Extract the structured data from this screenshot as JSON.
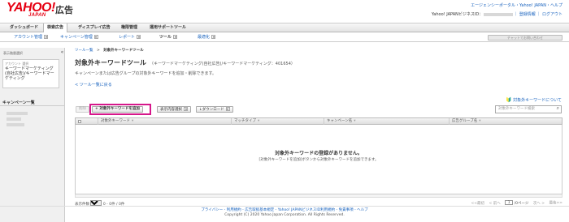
{
  "header": {
    "logo_main": "YAHOO!",
    "logo_sub": "JAPAN",
    "logo_product": "広告",
    "top_links": "エージェンシーポータル・Yahoo! JAPAN・ヘルプ",
    "user_prefix": "Yahoo! JAPANビジネスID：",
    "user_links": "｜ 登録情報 ｜ ログアウト"
  },
  "main_tabs": [
    {
      "label": "ダッシュボード"
    },
    {
      "label": "検索広告"
    },
    {
      "label": "ディスプレイ広告"
    },
    {
      "label": "権限管理"
    },
    {
      "label": "運用サポートツール"
    }
  ],
  "sub_nav": [
    {
      "label": "アカウント管理"
    },
    {
      "label": "キャンペーン管理"
    },
    {
      "label": "レポート"
    },
    {
      "label": "ツール"
    },
    {
      "label": "最適化"
    }
  ],
  "chat_button": "チャットでお問い合わせ",
  "sidebar": {
    "section_label": "表示階層選択",
    "account_type_label": "アカウント 選択",
    "account_name": "キーワードマーケティング(自社広告)/キーワードマーケティング",
    "collapse": "«",
    "campaign_header": "キャンペーン一覧"
  },
  "breadcrumb": {
    "parent": "ツール一覧",
    "separator": ">",
    "current": "対象外キーワードツール"
  },
  "page": {
    "title": "対象外キーワードツール",
    "account_info": "（キーワードマーケティング(自社広告)/キーワードマーケティング：401654）",
    "description": "キャンペーンまたは広告グループの対象外キーワードを追加・削除できます。",
    "back_link": "< ツール一覧に戻る",
    "about_link": "対象外キーワードについて"
  },
  "toolbar": {
    "delete": "削除",
    "add": "+ 対象外キーワードを追加",
    "view": "表示内容選択",
    "download": "↓ダウンロード",
    "search_placeholder": "対象外キーワード検索"
  },
  "table": {
    "columns": [
      {
        "label": "対象外キーワード"
      },
      {
        "label": "マッチタイプ"
      },
      {
        "label": "キャンペーン名"
      },
      {
        "label": "広告グループ名"
      }
    ],
    "empty_title": "対象外キーワードの登録がありません。",
    "empty_hint": "[対象外キーワードを追加]ボタンから対象外キーワードを追加できます。"
  },
  "pager": {
    "label": "表示件数",
    "per_page": "20件",
    "range": "0 - 0件 / 0件",
    "first": "<<最初",
    "prev": "< 前へ",
    "page": "1",
    "of": "/0ページ",
    "next": "次へ >",
    "last": "最後>>"
  },
  "footer": {
    "links": "プライバシー - 利用規約 - 広告取扱基本規定 - Yahoo! JAPANビジネスID利用規約 - 免責事項 - ヘルプ",
    "copyright": "Copyright (C) 2020 Yahoo Japan Corporation. All Rights Reserved."
  },
  "colors": {
    "brand": "#e60012",
    "link": "#1560bd",
    "highlight": "#d6178b"
  }
}
